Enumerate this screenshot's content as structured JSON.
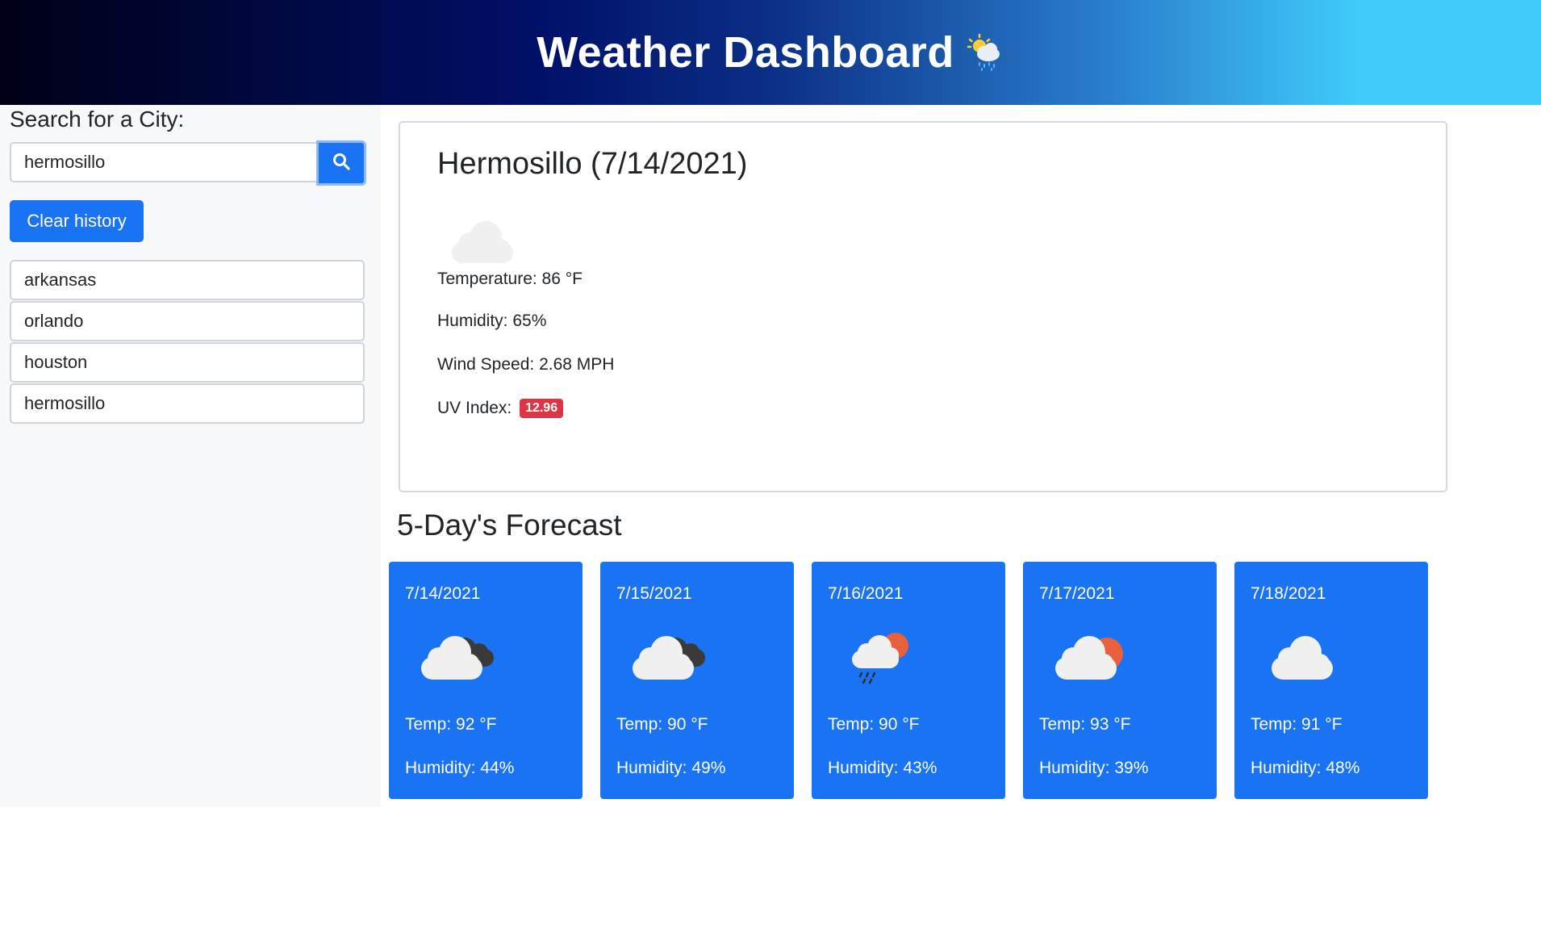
{
  "header": {
    "title": "Weather Dashboard",
    "icon": "sun-behind-rain-cloud-icon"
  },
  "sidebar": {
    "search_label": "Search for a City:",
    "search_value": "hermosillo",
    "search_icon": "search-icon",
    "clear_label": "Clear history",
    "history": [
      {
        "label": "arkansas"
      },
      {
        "label": "orlando"
      },
      {
        "label": "houston"
      },
      {
        "label": "hermosillo"
      }
    ]
  },
  "current": {
    "title": "Hermosillo (7/14/2021)",
    "icon": "cloud-icon",
    "temperature": "Temperature: 86 °F",
    "humidity": "Humidity: 65%",
    "wind": "Wind Speed: 2.68 MPH",
    "uv_label": "UV Index:",
    "uv_value": "12.96"
  },
  "forecast": {
    "title": "5-Day's Forecast",
    "days": [
      {
        "date": "7/14/2021",
        "icon": "broken-clouds-icon",
        "temp": "Temp: 92 °F",
        "humidity": "Humidity: 44%"
      },
      {
        "date": "7/15/2021",
        "icon": "broken-clouds-icon",
        "temp": "Temp: 90 °F",
        "humidity": "Humidity: 49%"
      },
      {
        "date": "7/16/2021",
        "icon": "rain-with-sun-icon",
        "temp": "Temp: 90 °F",
        "humidity": "Humidity: 43%"
      },
      {
        "date": "7/17/2021",
        "icon": "few-clouds-sun-icon",
        "temp": "Temp: 93 °F",
        "humidity": "Humidity: 39%"
      },
      {
        "date": "7/18/2021",
        "icon": "cloud-icon",
        "temp": "Temp: 91 °F",
        "humidity": "Humidity: 48%"
      }
    ]
  },
  "colors": {
    "primary": "#1a73f3",
    "danger": "#dc3545",
    "sidebar_bg": "#f7f8f9"
  }
}
